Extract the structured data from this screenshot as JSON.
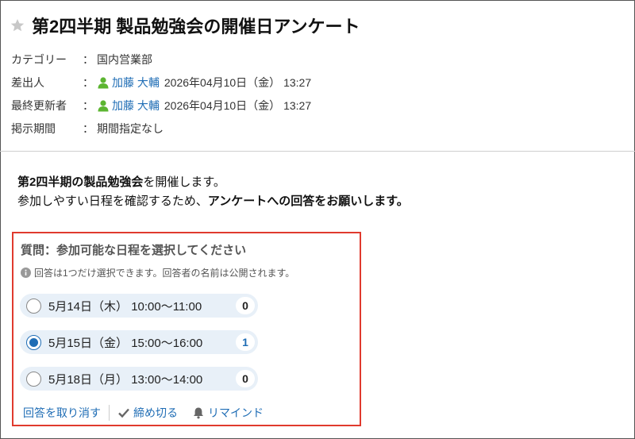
{
  "header": {
    "title": "第2四半期 製品勉強会の開催日アンケート"
  },
  "meta": {
    "category_label": "カテゴリー",
    "category_value": "国内営業部",
    "sender_label": "差出人",
    "sender_name": "加藤 大輔",
    "sender_date": "2026年04月10日（金） 13:27",
    "updater_label": "最終更新者",
    "updater_name": "加藤 大輔",
    "updater_date": "2026年04月10日（金） 13:27",
    "period_label": "掲示期間",
    "period_value": "期間指定なし",
    "separator": "："
  },
  "body": {
    "line1_bold": "第2四半期の製品勉強会",
    "line1_rest": "を開催します。",
    "line2_plain": "参加しやすい日程を確認するため、",
    "line2_bold": "アンケートへの回答をお願いします。"
  },
  "survey": {
    "question": "質問：参加可能な日程を選択してください",
    "note": "回答は1つだけ選択できます。回答者の名前は公開されます。",
    "options": [
      {
        "label": "5月14日（木） 10:00〜11:00",
        "count": "0",
        "selected": false
      },
      {
        "label": "5月15日（金） 15:00〜16:00",
        "count": "1",
        "selected": true
      },
      {
        "label": "5月18日（月） 13:00〜14:00",
        "count": "0",
        "selected": false
      }
    ],
    "actions": {
      "cancel": "回答を取り消す",
      "close": "締め切る",
      "remind": "リマインド"
    }
  },
  "colors": {
    "link": "#1f6db5",
    "highlight_border": "#e03a2e",
    "option_bg": "#e8f0f8"
  }
}
